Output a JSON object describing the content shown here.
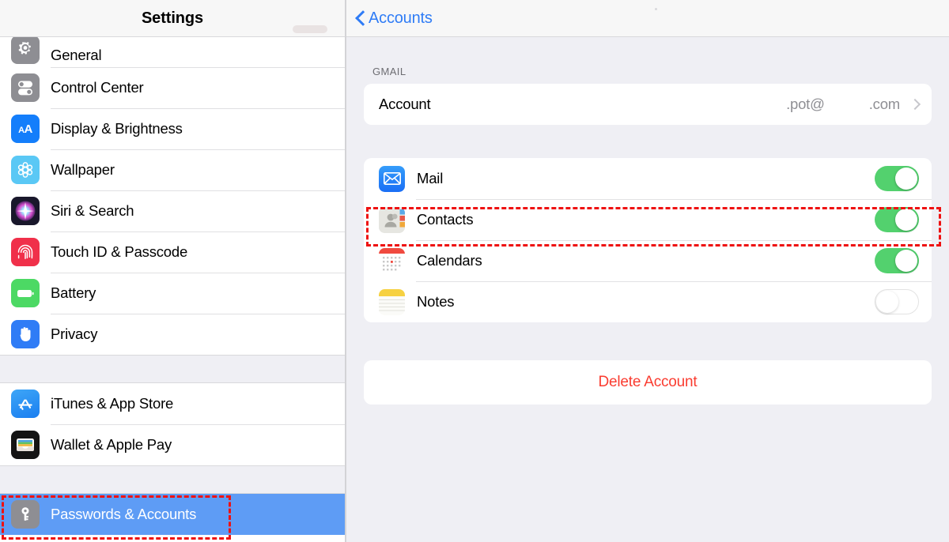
{
  "sidebar": {
    "title": "Settings",
    "groups": [
      {
        "items": [
          {
            "label": "General",
            "icon": "gear-icon",
            "clipped": true
          },
          {
            "label": "Control Center",
            "icon": "control-center-icon"
          },
          {
            "label": "Display & Brightness",
            "icon": "display-brightness-icon"
          },
          {
            "label": "Wallpaper",
            "icon": "wallpaper-icon"
          },
          {
            "label": "Siri & Search",
            "icon": "siri-icon"
          },
          {
            "label": "Touch ID & Passcode",
            "icon": "touch-id-icon"
          },
          {
            "label": "Battery",
            "icon": "battery-icon"
          },
          {
            "label": "Privacy",
            "icon": "privacy-hand-icon"
          }
        ]
      },
      {
        "items": [
          {
            "label": "iTunes & App Store",
            "icon": "app-store-icon"
          },
          {
            "label": "Wallet & Apple Pay",
            "icon": "wallet-icon"
          }
        ]
      },
      {
        "items": [
          {
            "label": "Passwords & Accounts",
            "icon": "key-icon",
            "selected": true
          }
        ]
      }
    ],
    "display_icon_text": "AA",
    "app_store_icon_text": "A"
  },
  "panel": {
    "back_label": "Accounts",
    "back_icon": "chevron-left-icon",
    "group_label": "GMAIL",
    "account_row": {
      "label": "Account",
      "value_left": ".pot@",
      "value_right": ".com",
      "chevron": "chevron-right-icon"
    },
    "services": [
      {
        "label": "Mail",
        "icon": "mail-icon",
        "enabled": true,
        "state": "on"
      },
      {
        "label": "Contacts",
        "icon": "contacts-icon",
        "enabled": true,
        "state": "on"
      },
      {
        "label": "Calendars",
        "icon": "calendars-icon",
        "enabled": true,
        "state": "on"
      },
      {
        "label": "Notes",
        "icon": "notes-icon",
        "enabled": false,
        "state": "off"
      }
    ],
    "delete_label": "Delete Account"
  },
  "annotations": [
    {
      "name": "contacts-row-highlight",
      "color": "#ee1111",
      "style": "dashed"
    },
    {
      "name": "passwords-accounts-highlight",
      "color": "#ee1111",
      "style": "dashed"
    }
  ],
  "colors": {
    "accent_blue": "#2f7cf6",
    "selection_blue": "#5e9cf5",
    "toggle_on_green": "#53d16e",
    "destructive_red": "#fa3c30",
    "panel_background": "#efeff4",
    "annotation_red": "#ee1111"
  }
}
